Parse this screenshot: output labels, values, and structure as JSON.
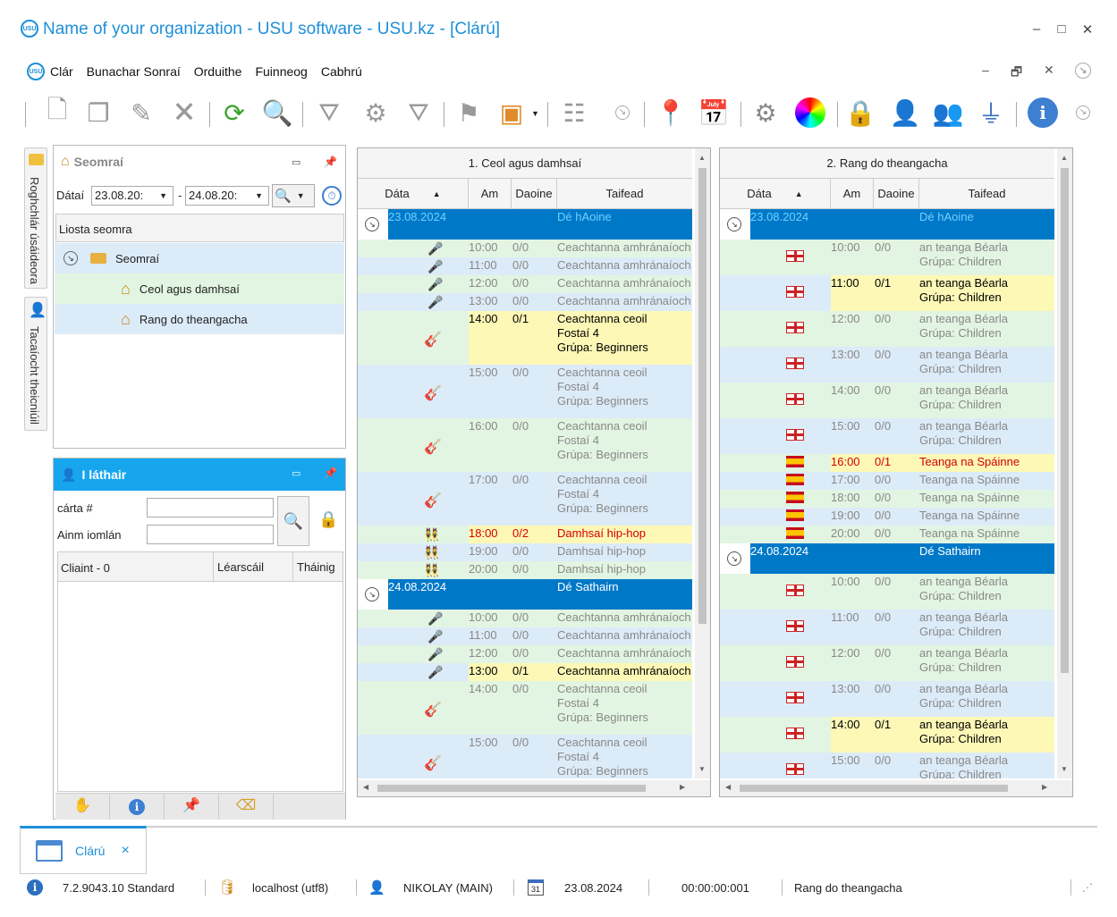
{
  "window": {
    "title": "Name of your organization - USU software - USU.kz - [Clárú]",
    "logo": "usu"
  },
  "menu": [
    "Clár",
    "Bunachar Sonraí",
    "Orduithe",
    "Fuinneog",
    "Cabhrú"
  ],
  "side_tabs": {
    "user_settings": "Roghchlár úsáideora",
    "tech_support": "Tacaíocht theicniúil"
  },
  "rooms_panel": {
    "title": "Seomraí",
    "dates_label": "Dátaí",
    "date_from": "23.08.20:",
    "date_to": "24.08.20:",
    "date_sep": "-",
    "list_header": "Liosta seomra",
    "root": "Seomraí",
    "rooms": [
      "Ceol agus damhsaí",
      "Rang do theangacha"
    ]
  },
  "presence_panel": {
    "title": "I láthair",
    "card_label": "cárta #",
    "name_label": "Ainm iomlán",
    "cols": [
      "Cliaint - 0",
      "Léarscáil",
      "Tháinig"
    ]
  },
  "grid_cols": {
    "date": "Dáta",
    "time": "Am",
    "people": "Daoine",
    "record": "Taifead"
  },
  "grid1": {
    "title": "1. Ceol agus damhsaí",
    "days": [
      {
        "date": "23.08.2024",
        "day": "Dé hAoine",
        "rows": [
          {
            "t": "10:00",
            "p": "0/0",
            "r": [
              "Ceachtanna amhránaíoch"
            ],
            "ic": "mic",
            "bg": "g",
            "st": "n"
          },
          {
            "t": "11:00",
            "p": "0/0",
            "r": [
              "Ceachtanna amhránaíoch"
            ],
            "ic": "mic",
            "bg": "b",
            "st": "n"
          },
          {
            "t": "12:00",
            "p": "0/0",
            "r": [
              "Ceachtanna amhránaíoch"
            ],
            "ic": "mic",
            "bg": "g",
            "st": "n"
          },
          {
            "t": "13:00",
            "p": "0/0",
            "r": [
              "Ceachtanna amhránaíoch"
            ],
            "ic": "mic",
            "bg": "b",
            "st": "n"
          },
          {
            "t": "14:00",
            "p": "0/1",
            "r": [
              "Ceachtanna ceoil",
              "Fostaí 4",
              "Grúpa: Beginners"
            ],
            "ic": "guitar",
            "bg": "g",
            "st": "y"
          },
          {
            "t": "15:00",
            "p": "0/0",
            "r": [
              "Ceachtanna ceoil",
              "Fostaí 4",
              "Grúpa: Beginners"
            ],
            "ic": "guitar",
            "bg": "b",
            "st": "n"
          },
          {
            "t": "16:00",
            "p": "0/0",
            "r": [
              "Ceachtanna ceoil",
              "Fostaí 4",
              "Grúpa: Beginners"
            ],
            "ic": "guitar",
            "bg": "g",
            "st": "n"
          },
          {
            "t": "17:00",
            "p": "0/0",
            "r": [
              "Ceachtanna ceoil",
              "Fostaí 4",
              "Grúpa: Beginners"
            ],
            "ic": "guitar",
            "bg": "b",
            "st": "n"
          },
          {
            "t": "18:00",
            "p": "0/2",
            "r": [
              "Damhsaí hip-hop"
            ],
            "ic": "dance",
            "bg": "g",
            "st": "r"
          },
          {
            "t": "19:00",
            "p": "0/0",
            "r": [
              "Damhsaí hip-hop"
            ],
            "ic": "dance",
            "bg": "b",
            "st": "n"
          },
          {
            "t": "20:00",
            "p": "0/0",
            "r": [
              "Damhsaí hip-hop"
            ],
            "ic": "dance",
            "bg": "g",
            "st": "n"
          }
        ]
      },
      {
        "date": "24.08.2024",
        "day": "Dé Sathairn",
        "rows": [
          {
            "t": "10:00",
            "p": "0/0",
            "r": [
              "Ceachtanna amhránaíoch"
            ],
            "ic": "mic",
            "bg": "g",
            "st": "n"
          },
          {
            "t": "11:00",
            "p": "0/0",
            "r": [
              "Ceachtanna amhránaíoch"
            ],
            "ic": "mic",
            "bg": "b",
            "st": "n"
          },
          {
            "t": "12:00",
            "p": "0/0",
            "r": [
              "Ceachtanna amhránaíoch"
            ],
            "ic": "mic",
            "bg": "g",
            "st": "n"
          },
          {
            "t": "13:00",
            "p": "0/1",
            "r": [
              "Ceachtanna amhránaíoch"
            ],
            "ic": "mic",
            "bg": "b",
            "st": "y"
          },
          {
            "t": "14:00",
            "p": "0/0",
            "r": [
              "Ceachtanna ceoil",
              "Fostaí 4",
              "Grúpa: Beginners"
            ],
            "ic": "guitar",
            "bg": "g",
            "st": "n"
          },
          {
            "t": "15:00",
            "p": "0/0",
            "r": [
              "Ceachtanna ceoil",
              "Fostaí 4",
              "Grúpa: Beginners"
            ],
            "ic": "guitar",
            "bg": "b",
            "st": "n"
          }
        ]
      }
    ]
  },
  "grid2": {
    "title": "2. Rang do theangacha",
    "days": [
      {
        "date": "23.08.2024",
        "day": "Dé hAoine",
        "rows": [
          {
            "t": "10:00",
            "p": "0/0",
            "r": [
              "an teanga Béarla",
              "Grúpa: Children"
            ],
            "ic": "uk",
            "bg": "g",
            "st": "n"
          },
          {
            "t": "11:00",
            "p": "0/1",
            "r": [
              "an teanga Béarla",
              "Grúpa: Children"
            ],
            "ic": "uk",
            "bg": "b",
            "st": "y"
          },
          {
            "t": "12:00",
            "p": "0/0",
            "r": [
              "an teanga Béarla",
              "Grúpa: Children"
            ],
            "ic": "uk",
            "bg": "g",
            "st": "n"
          },
          {
            "t": "13:00",
            "p": "0/0",
            "r": [
              "an teanga Béarla",
              "Grúpa: Children"
            ],
            "ic": "uk",
            "bg": "b",
            "st": "n"
          },
          {
            "t": "14:00",
            "p": "0/0",
            "r": [
              "an teanga Béarla",
              "Grúpa: Children"
            ],
            "ic": "uk",
            "bg": "g",
            "st": "n"
          },
          {
            "t": "15:00",
            "p": "0/0",
            "r": [
              "an teanga Béarla",
              "Grúpa: Children"
            ],
            "ic": "uk",
            "bg": "b",
            "st": "n"
          },
          {
            "t": "16:00",
            "p": "0/1",
            "r": [
              "Teanga na Spáinne"
            ],
            "ic": "es",
            "bg": "g",
            "st": "r"
          },
          {
            "t": "17:00",
            "p": "0/0",
            "r": [
              "Teanga na Spáinne"
            ],
            "ic": "es",
            "bg": "b",
            "st": "n"
          },
          {
            "t": "18:00",
            "p": "0/0",
            "r": [
              "Teanga na Spáinne"
            ],
            "ic": "es",
            "bg": "g",
            "st": "n"
          },
          {
            "t": "19:00",
            "p": "0/0",
            "r": [
              "Teanga na Spáinne"
            ],
            "ic": "es",
            "bg": "b",
            "st": "n"
          },
          {
            "t": "20:00",
            "p": "0/0",
            "r": [
              "Teanga na Spáinne"
            ],
            "ic": "es",
            "bg": "g",
            "st": "n"
          }
        ]
      },
      {
        "date": "24.08.2024",
        "day": "Dé Sathairn",
        "rows": [
          {
            "t": "10:00",
            "p": "0/0",
            "r": [
              "an teanga Béarla",
              "Grúpa: Children"
            ],
            "ic": "uk",
            "bg": "g",
            "st": "n"
          },
          {
            "t": "11:00",
            "p": "0/0",
            "r": [
              "an teanga Béarla",
              "Grúpa: Children"
            ],
            "ic": "uk",
            "bg": "b",
            "st": "n"
          },
          {
            "t": "12:00",
            "p": "0/0",
            "r": [
              "an teanga Béarla",
              "Grúpa: Children"
            ],
            "ic": "uk",
            "bg": "g",
            "st": "n"
          },
          {
            "t": "13:00",
            "p": "0/0",
            "r": [
              "an teanga Béarla",
              "Grúpa: Children"
            ],
            "ic": "uk",
            "bg": "b",
            "st": "n"
          },
          {
            "t": "14:00",
            "p": "0/1",
            "r": [
              "an teanga Béarla",
              "Grúpa: Children"
            ],
            "ic": "uk",
            "bg": "g",
            "st": "y"
          },
          {
            "t": "15:00",
            "p": "0/0",
            "r": [
              "an teanga Béarla",
              "Grúpa: Children"
            ],
            "ic": "uk",
            "bg": "b",
            "st": "n"
          }
        ]
      }
    ]
  },
  "doc_tab": {
    "label": "Clárú",
    "close": "×"
  },
  "status": {
    "version": "7.2.9043.10 Standard",
    "db": "localhost (utf8)",
    "user": "NIKOLAY (MAIN)",
    "date": "23.08.2024",
    "timer": "00:00:00:001",
    "room": "Rang do theangacha",
    "cal_day": "31"
  },
  "colors": {
    "accent": "#1e8fd8",
    "day_header": "#0078c8",
    "row_green": "#e2f5e2",
    "row_blue": "#dcebf8",
    "row_yellow": "#fdf8b6",
    "red_text": "#d40000"
  }
}
